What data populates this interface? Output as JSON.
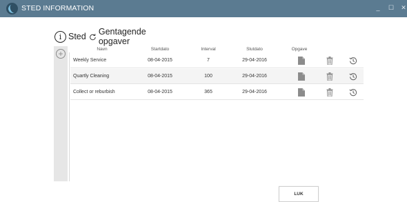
{
  "window": {
    "title": "STED INFORMATION",
    "min_label": "_",
    "max_label": "☐",
    "close_label": "✕"
  },
  "tabs": [
    {
      "label": "Sted",
      "icon": "info-icon"
    },
    {
      "label": "Gentagende opgaver",
      "icon": "refresh-icon"
    }
  ],
  "sidebar": {
    "add_label": "+"
  },
  "table": {
    "headers": {
      "navn": "Navn",
      "startdato": "Startdato",
      "interval": "Interval",
      "slutdato": "Slutdato",
      "opgave": "Opgave"
    },
    "rows": [
      {
        "navn": "Weekly Service",
        "startdato": "08-04-2015",
        "interval": "7",
        "slutdato": "29-04-2016"
      },
      {
        "navn": "Quartly Cleaning",
        "startdato": "08-04-2015",
        "interval": "100",
        "slutdato": "29-04-2016"
      },
      {
        "navn": "Collect or reburbish",
        "startdato": "08-04-2015",
        "interval": "365",
        "slutdato": "29-04-2016"
      }
    ]
  },
  "footer": {
    "close_button": "LUK"
  }
}
